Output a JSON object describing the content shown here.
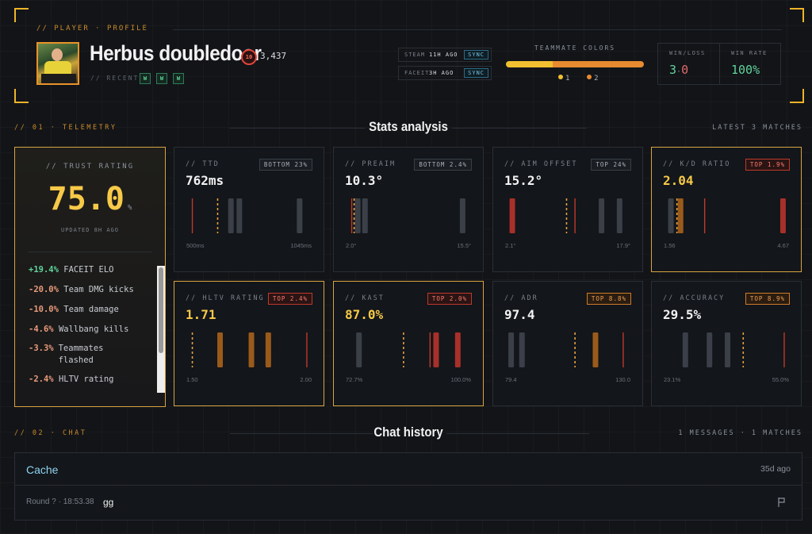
{
  "header": {
    "section_label": "// PLAYER · PROFILE",
    "player_name": "Herbus doubledoor",
    "level": "10",
    "elo": "3,437",
    "recent_label": "// RECENT",
    "recent": [
      "W",
      "W",
      "W"
    ],
    "sync": [
      {
        "source": "STEAM",
        "ago": "11H AGO",
        "button": "SYNC"
      },
      {
        "source": "FACEIT",
        "ago": "3H AGO",
        "button": "SYNC"
      }
    ],
    "teammate_colors": {
      "label": "TEAMMATE COLORS",
      "legend": [
        {
          "label": "1",
          "color": "#f0c030"
        },
        {
          "label": "2",
          "color": "#e88a30"
        }
      ]
    },
    "win_loss": {
      "label": "WIN/LOSS",
      "wins": "3",
      "sep": "·",
      "losses": "0"
    },
    "win_rate": {
      "label": "WIN RATE",
      "value": "100%"
    }
  },
  "telemetry": {
    "section_label": "// 01 · TELEMETRY",
    "title": "Stats analysis",
    "right_label": "LATEST 3 MATCHES"
  },
  "trust": {
    "label": "// TRUST RATING",
    "value": "75.0",
    "unit": "%",
    "updated": "UPDATED 8H AGO",
    "factors": [
      {
        "delta": "+19.4%",
        "label": "FACEIT ELO",
        "sign": "pos"
      },
      {
        "delta": "-20.0%",
        "label": "Team DMG kicks",
        "sign": "neg"
      },
      {
        "delta": "-10.0%",
        "label": "Team damage",
        "sign": "neg"
      },
      {
        "delta": "-4.6%",
        "label": "Wallbang kills",
        "sign": "neg"
      },
      {
        "delta": "-3.3%",
        "label": "Teammates flashed",
        "sign": "neg"
      },
      {
        "delta": "-2.4%",
        "label": "HLTV rating",
        "sign": "neg"
      }
    ]
  },
  "stats": [
    {
      "label": "// TTD",
      "badge": "BOTTOM 23%",
      "badge_style": "gray",
      "value": "762ms",
      "value_style": "white",
      "min": "500ms",
      "max": "1045ms",
      "marks": [
        {
          "t": "line",
          "p": 0.03,
          "c": "#c0392b"
        },
        {
          "t": "dash",
          "p": 0.24,
          "c": "#e8a040"
        },
        {
          "t": "bar",
          "p": 0.35,
          "c": "#3a3f48"
        },
        {
          "t": "bar",
          "p": 0.42,
          "c": "#3a3f48"
        },
        {
          "t": "bar",
          "p": 0.92,
          "c": "#3a3f48"
        }
      ]
    },
    {
      "label": "// PREAIM",
      "badge": "BOTTOM 2.4%",
      "badge_style": "gray",
      "value": "10.3°",
      "value_style": "white",
      "min": "2.0°",
      "max": "15.5°",
      "marks": [
        {
          "t": "line",
          "p": 0.03,
          "c": "#c0392b"
        },
        {
          "t": "dash",
          "p": 0.05,
          "c": "#e8a040"
        },
        {
          "t": "bar",
          "p": 0.08,
          "c": "#3a3f48"
        },
        {
          "t": "bar",
          "p": 0.14,
          "c": "#3a3f48"
        },
        {
          "t": "bar",
          "p": 0.95,
          "c": "#3a3f48"
        }
      ]
    },
    {
      "label": "// AIM OFFSET",
      "badge": "TOP 24%",
      "badge_style": "gray",
      "value": "15.2°",
      "value_style": "white",
      "min": "2.1°",
      "max": "17.9°",
      "marks": [
        {
          "t": "bar",
          "p": 0.04,
          "c": "#a8302a"
        },
        {
          "t": "dash",
          "p": 0.49,
          "c": "#e8a040"
        },
        {
          "t": "line",
          "p": 0.56,
          "c": "#c0392b"
        },
        {
          "t": "bar",
          "p": 0.78,
          "c": "#3a3f48"
        },
        {
          "t": "bar",
          "p": 0.93,
          "c": "#3a3f48"
        }
      ]
    },
    {
      "label": "// K/D RATIO",
      "badge": "TOP 1.9%",
      "badge_style": "red",
      "value": "2.04",
      "value_style": "gold",
      "min": "1.56",
      "max": "4.67",
      "marks": [
        {
          "t": "bar",
          "p": 0.04,
          "c": "#3a3f48"
        },
        {
          "t": "dash",
          "p": 0.09,
          "c": "#e8a040"
        },
        {
          "t": "bar",
          "p": 0.12,
          "c": "#9a5a1a"
        },
        {
          "t": "line",
          "p": 0.32,
          "c": "#c0392b"
        },
        {
          "t": "bar",
          "p": 0.97,
          "c": "#a8302a"
        }
      ]
    },
    {
      "label": "// HLTV RATING",
      "badge": "TOP 2.4%",
      "badge_style": "red",
      "value": "1.71",
      "value_style": "gold",
      "min": "1.50",
      "max": "2.00",
      "marks": [
        {
          "t": "dash",
          "p": 0.03,
          "c": "#e8a040"
        },
        {
          "t": "bar",
          "p": 0.26,
          "c": "#9a5a1a"
        },
        {
          "t": "bar",
          "p": 0.52,
          "c": "#9a5a1a"
        },
        {
          "t": "bar",
          "p": 0.66,
          "c": "#9a5a1a"
        },
        {
          "t": "line",
          "p": 0.98,
          "c": "#c0392b"
        }
      ]
    },
    {
      "label": "// KAST",
      "badge": "TOP 2.0%",
      "badge_style": "red",
      "value": "87.0%",
      "value_style": "gold",
      "min": "72.7%",
      "max": "100.0%",
      "marks": [
        {
          "t": "bar",
          "p": 0.09,
          "c": "#3a3f48"
        },
        {
          "t": "dash",
          "p": 0.46,
          "c": "#e8a040"
        },
        {
          "t": "line",
          "p": 0.68,
          "c": "#c0392b"
        },
        {
          "t": "bar",
          "p": 0.73,
          "c": "#a8302a"
        },
        {
          "t": "bar",
          "p": 0.91,
          "c": "#a8302a"
        }
      ]
    },
    {
      "label": "// ADR",
      "badge": "TOP 8.8%",
      "badge_style": "orange",
      "value": "97.4",
      "value_style": "white",
      "min": "79.4",
      "max": "130.0",
      "marks": [
        {
          "t": "bar",
          "p": 0.03,
          "c": "#3a3f48"
        },
        {
          "t": "bar",
          "p": 0.12,
          "c": "#3a3f48"
        },
        {
          "t": "dash",
          "p": 0.56,
          "c": "#e8a040"
        },
        {
          "t": "bar",
          "p": 0.73,
          "c": "#9a5a1a"
        },
        {
          "t": "line",
          "p": 0.96,
          "c": "#c0392b"
        }
      ]
    },
    {
      "label": "// ACCURACY",
      "badge": "TOP 8.9%",
      "badge_style": "orange",
      "value": "29.5%",
      "value_style": "white",
      "min": "23.1%",
      "max": "55.0%",
      "marks": [
        {
          "t": "bar",
          "p": 0.16,
          "c": "#3a3f48"
        },
        {
          "t": "bar",
          "p": 0.36,
          "c": "#3a3f48"
        },
        {
          "t": "bar",
          "p": 0.51,
          "c": "#3a3f48"
        },
        {
          "t": "dash",
          "p": 0.64,
          "c": "#e8a040"
        },
        {
          "t": "line",
          "p": 0.98,
          "c": "#c0392b"
        }
      ]
    }
  ],
  "chat": {
    "section_label": "// 02 · CHAT",
    "title": "Chat history",
    "right_label": "1 MESSAGES · 1 MATCHES",
    "map": "Cache",
    "ago": "35d ago",
    "messages": [
      {
        "meta": "Round ? · 18:53.38",
        "text": "gg"
      }
    ]
  }
}
